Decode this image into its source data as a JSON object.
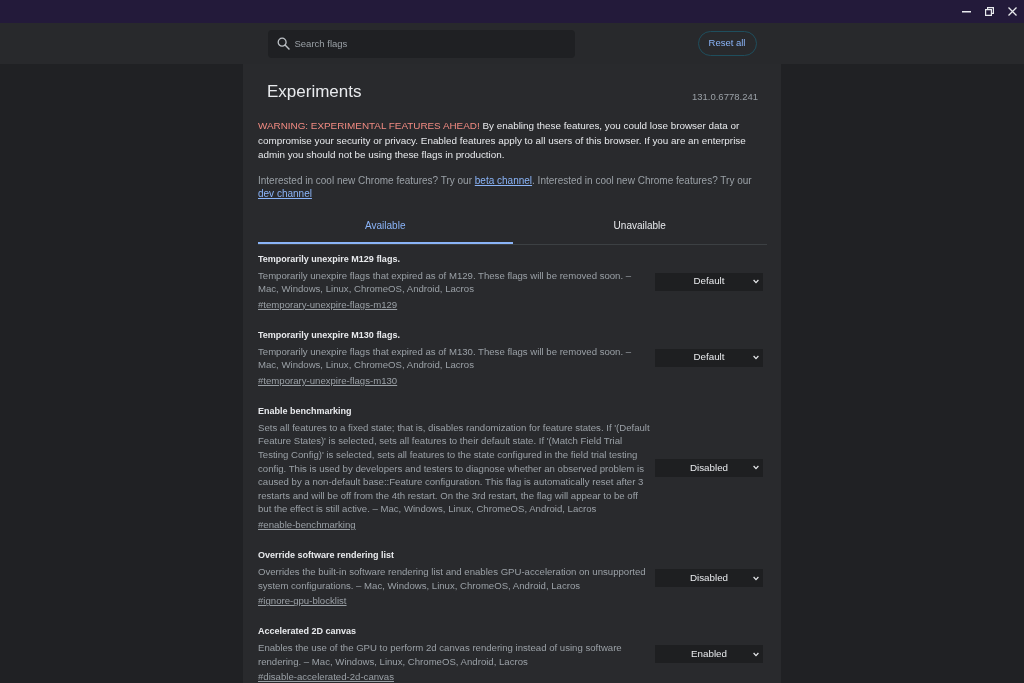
{
  "toolbar": {
    "search": {
      "placeholder": "Search flags"
    },
    "reset_button": "Reset all"
  },
  "header": {
    "title": "Experiments",
    "version": "131.0.6778.241"
  },
  "warning": {
    "label": "WARNING: EXPERIMENTAL FEATURES AHEAD!",
    "text": "By enabling these features, you could lose browser data or compromise your security or privacy. Enabled features apply to all users of this browser. If you are an enterprise admin you should not be using these flags in production."
  },
  "channels_note": [
    {
      "kind": "text",
      "text": "Interested in cool new Chrome features? Try our"
    },
    {
      "kind": "link",
      "text": "beta channel"
    },
    {
      "kind": "text",
      "text": ". Interested in cool new Chrome features? Try our"
    },
    {
      "kind": "link",
      "text": "dev channel"
    }
  ],
  "tabs": [
    {
      "label": "Available",
      "selected": true
    },
    {
      "label": "Unavailable",
      "selected": false
    }
  ],
  "flags": [
    {
      "title": "Temporarily unexpire M129 flags.",
      "description": "Temporarily unexpire flags that expired as of M129. These flags will be removed soon. – Mac, Windows, Linux, ChromeOS, Android, Lacros",
      "link": "#temporary-unexpire-flags-m129",
      "value": "Default"
    },
    {
      "title": "Temporarily unexpire M130 flags.",
      "description": "Temporarily unexpire flags that expired as of M130. These flags will be removed soon. – Mac, Windows, Linux, ChromeOS, Android, Lacros",
      "link": "#temporary-unexpire-flags-m130",
      "value": "Default"
    },
    {
      "title": "Enable benchmarking",
      "description": "Sets all features to a fixed state; that is, disables randomization for feature states. If '(Default Feature States)' is selected, sets all features to their default state. If '(Match Field Trial Testing Config)' is selected, sets all features to the state configured in the field trial testing config. This is used by developers and testers to diagnose whether an observed problem is caused by a non-default base::Feature configuration. This flag is automatically reset after 3 restarts and will be off from the 4th restart. On the 3rd restart, the flag will appear to be off but the effect is still active. – Mac, Windows, Linux, ChromeOS, Android, Lacros",
      "link": "#enable-benchmarking",
      "value": "Disabled"
    },
    {
      "title": "Override software rendering list",
      "description": "Overrides the built-in software rendering list and enables GPU-acceleration on unsupported system configurations. – Mac, Windows, Linux, ChromeOS, Android, Lacros",
      "link": "#ignore-gpu-blocklist",
      "value": "Disabled"
    },
    {
      "title": "Accelerated 2D canvas",
      "description": "Enables the use of the GPU to perform 2d canvas rendering instead of using software rendering. – Mac, Windows, Linux, ChromeOS, Android, Lacros",
      "link": "#disable-accelerated-2d-canvas",
      "value": "Enabled"
    }
  ]
}
